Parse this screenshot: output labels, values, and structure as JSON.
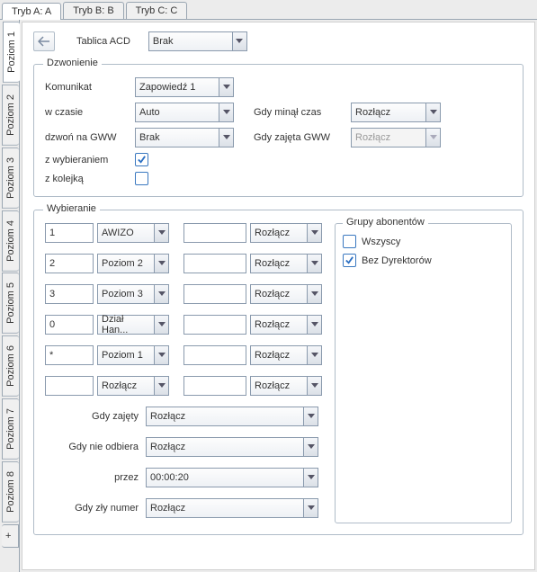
{
  "top_tabs": [
    "Tryb A: A",
    "Tryb B: B",
    "Tryb C: C"
  ],
  "vtabs": [
    "Poziom 1",
    "Poziom 2",
    "Poziom 3",
    "Poziom 4",
    "Poziom 5",
    "Poziom 6",
    "Poziom 7",
    "Poziom 8"
  ],
  "vtab_plus": "+",
  "acd": {
    "label": "Tablica ACD",
    "value": "Brak"
  },
  "dzwonienie": {
    "legend": "Dzwonienie",
    "komunikat_lbl": "Komunikat",
    "komunikat_val": "Zapowiedź 1",
    "wczasie_lbl": "w czasie",
    "wczasie_val": "Auto",
    "gdy_minal_lbl": "Gdy minął czas",
    "gdy_minal_val": "Rozłącz",
    "dzwon_lbl": "dzwoń na GWW",
    "dzwon_val": "Brak",
    "gdy_zajeta_lbl": "Gdy zajęta GWW",
    "gdy_zajeta_val": "Rozłącz",
    "zwyb_lbl": "z wybieraniem",
    "zwyb_checked": true,
    "zkol_lbl": "z kolejką",
    "zkol_checked": false
  },
  "wybieranie": {
    "legend": "Wybieranie",
    "rows": [
      {
        "digit": "1",
        "sel1": "AWIZO",
        "in2": "",
        "sel2": "Rozłącz"
      },
      {
        "digit": "2",
        "sel1": "Poziom 2",
        "in2": "",
        "sel2": "Rozłącz"
      },
      {
        "digit": "3",
        "sel1": "Poziom 3",
        "in2": "",
        "sel2": "Rozłącz"
      },
      {
        "digit": "0",
        "sel1": "Dział Han...",
        "in2": "",
        "sel2": "Rozłącz"
      },
      {
        "digit": "*",
        "sel1": "Poziom 1",
        "in2": "",
        "sel2": "Rozłącz"
      },
      {
        "digit": "",
        "sel1": "Rozłącz",
        "in2": "",
        "sel2": "Rozłącz"
      }
    ],
    "gdy_zajety_lbl": "Gdy zajęty",
    "gdy_zajety_val": "Rozłącz",
    "gdy_nieodb_lbl": "Gdy nie odbiera",
    "gdy_nieodb_val": "Rozłącz",
    "przez_lbl": "przez",
    "przez_val": "00:00:20",
    "gdy_zly_lbl": "Gdy zły numer",
    "gdy_zly_val": "Rozłącz"
  },
  "grupy": {
    "legend": "Grupy abonentów",
    "wszyscy_lbl": "Wszyscy",
    "wszyscy_checked": false,
    "bez_lbl": "Bez Dyrektorów",
    "bez_checked": true
  }
}
